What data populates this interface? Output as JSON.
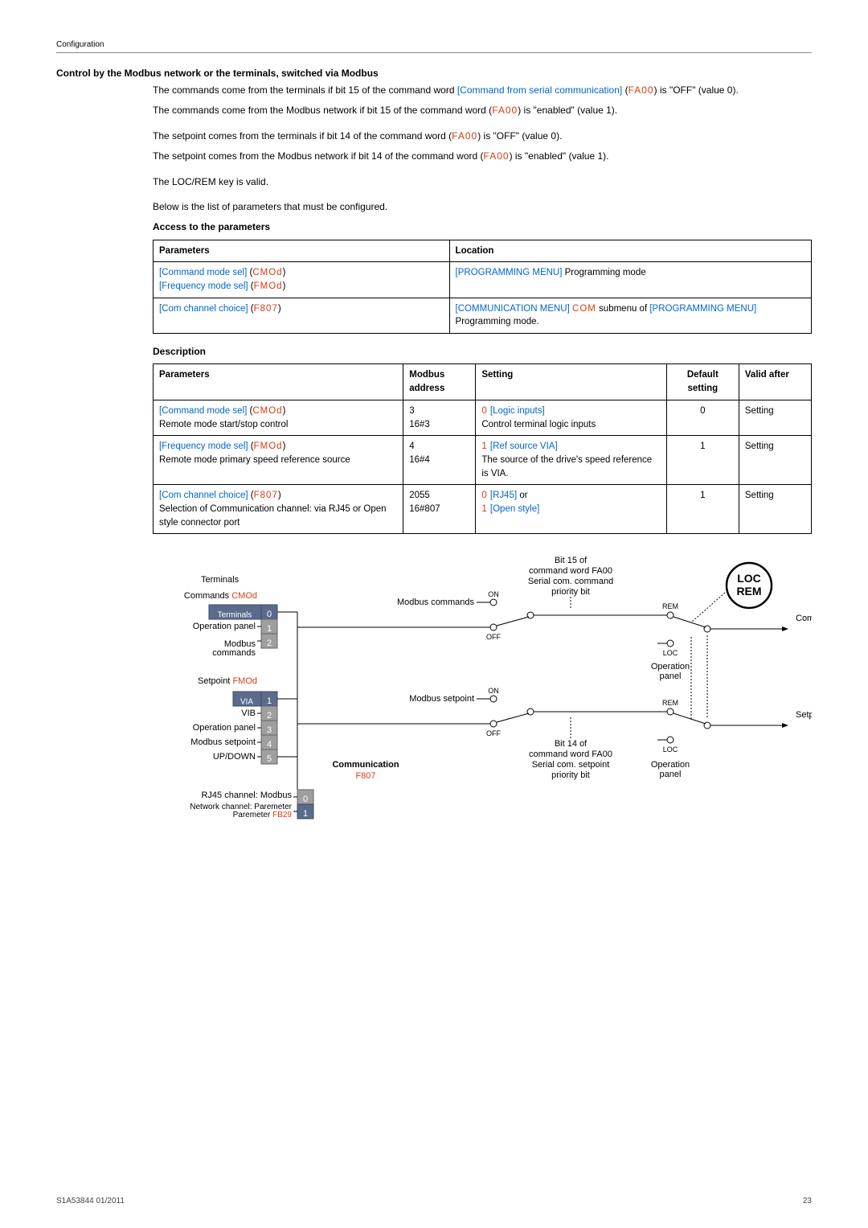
{
  "header": {
    "section": "Configuration"
  },
  "title": "Control by the Modbus network or the terminals, switched via Modbus",
  "intro": {
    "p1a": "The commands come from the terminals if bit 15 of the command word ",
    "p1_link": "[Command from serial communication]",
    "p1_code": "FA00",
    "p1b": " is \"OFF\" (value 0).",
    "p2a": "The commands come from the Modbus network if bit 15 of the command word (",
    "p2_code": "FA00",
    "p2b": ") is \"enabled\" (value 1).",
    "p3a": "The setpoint comes from the terminals if bit 14 of the command word (",
    "p3_code": "FA00",
    "p3b": ") is \"OFF\" (value 0).",
    "p4a": "The setpoint comes from the Modbus network if bit 14 of the command word (",
    "p4_code": "FA00",
    "p4b": ") is \"enabled\" (value 1).",
    "p5": "The LOC/REM key is valid.",
    "p6": "Below is the list of parameters that must be configured."
  },
  "access": {
    "title": "Access to the parameters",
    "head": {
      "c1": "Parameters",
      "c2": "Location"
    },
    "rows": [
      {
        "p1_link": "[Command mode sel]",
        "p1_code": "CMOd",
        "p2_link": "[Frequency mode sel]",
        "p2_code": "FMOd",
        "loc_link": "[PROGRAMMING MENU]",
        "loc_text": " Programming mode"
      },
      {
        "p1_link": "[Com channel choice]",
        "p1_code": "F807",
        "loc1_link": "[COMMUNICATION MENU]",
        "loc1_code": "COM",
        "loc1_text": " submenu of ",
        "loc2_link": "[PROGRAMMING MENU]",
        "loc2_text": " Programming mode."
      }
    ]
  },
  "desc": {
    "title": "Description",
    "head": {
      "c1": "Parameters",
      "c2": "Modbus address",
      "c3": "Setting",
      "c4": "Default setting",
      "c5": "Valid after"
    },
    "rows": [
      {
        "p_link": "[Command mode sel]",
        "p_code": "CMOd",
        "p_text": "Remote mode start/stop control",
        "addr1": "3",
        "addr2": "16#3",
        "s_code": "0",
        "s_link": "[Logic inputs]",
        "s_text": "Control terminal logic inputs",
        "def": "0",
        "after": "Setting"
      },
      {
        "p_link": "[Frequency mode sel]",
        "p_code": "FMOd",
        "p_text": "Remote mode primary speed reference source",
        "addr1": "4",
        "addr2": "16#4",
        "s_code": "1",
        "s_link": "[Ref source VIA]",
        "s_text": "The source of the drive's speed reference is VIA.",
        "def": "1",
        "after": "Setting"
      },
      {
        "p_link": "[Com channel choice]",
        "p_code": "F807",
        "p_text": "Selection of Communication channel: via RJ45 or Open style connector port",
        "addr1": "2055",
        "addr2": "16#807",
        "s_code": "0",
        "s_link": "[RJ45]",
        "s_or": " or",
        "s_code2": "1",
        "s_link2": "[Open style]",
        "def": "1",
        "after": "Setting"
      }
    ]
  },
  "diagram": {
    "terminals": "Terminals",
    "commands_lbl": "Commands",
    "commands_code": "CMOd",
    "cmd_sel": [
      "Terminals",
      "Operation panel",
      "Modbus commands"
    ],
    "setpoint_lbl": "Setpoint",
    "setpoint_code": "FMOd",
    "sp_sel": [
      "VIA",
      "VIB",
      "Operation panel",
      "Modbus setpoint",
      "UP/DOWN"
    ],
    "comm_lbl": "Communication",
    "comm_code": "F807",
    "comm_sel": [
      "RJ45 channel: Modbus",
      "Network channel: Paremeter",
      "FB29"
    ],
    "bit15": [
      "Bit 15 of",
      "command word FA00",
      "Serial com. command",
      "priority bit"
    ],
    "bit14": [
      "Bit 14 of",
      "command word FA00",
      "Serial com. setpoint",
      "priority bit"
    ],
    "modbus_cmd": "Modbus commands",
    "modbus_sp": "Modbus setpoint",
    "on": "ON",
    "off": "OFF",
    "loc": "LOC",
    "rem": "REM",
    "locrem": "LOC REM",
    "op_panel": "Operation panel",
    "out_cmd": "Commands",
    "out_sp": "Setpoint"
  },
  "footer": {
    "left": "S1A53844 01/2011",
    "right": "23"
  }
}
